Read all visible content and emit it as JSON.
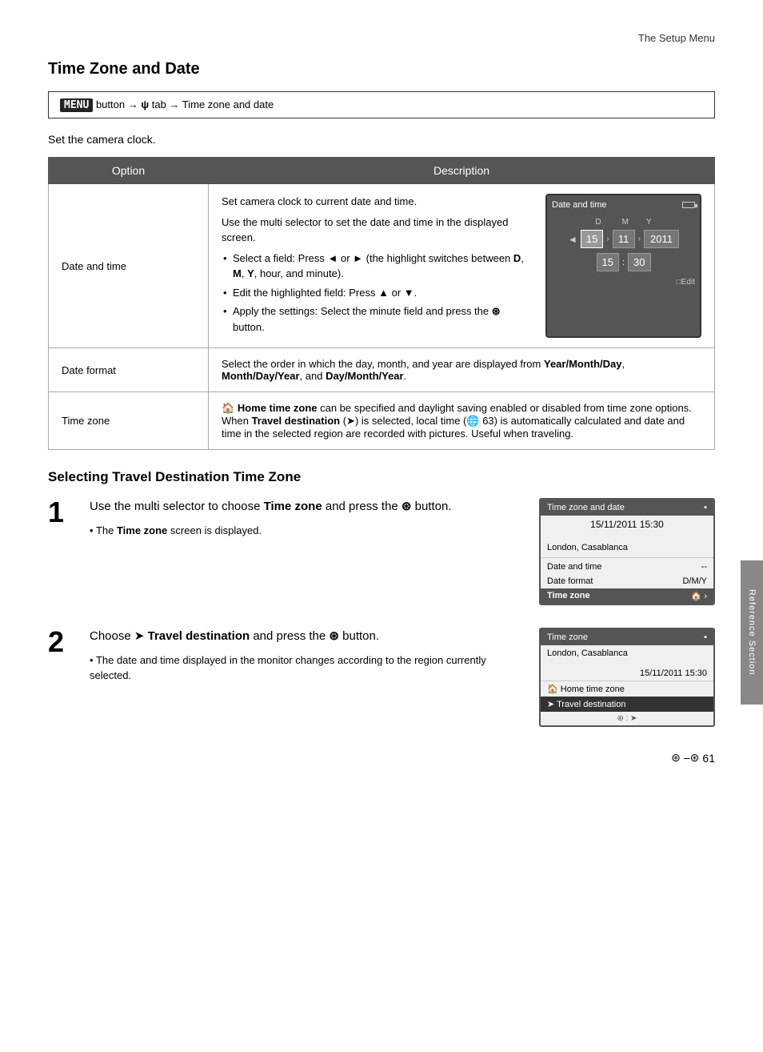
{
  "header": {
    "section_title": "The Setup Menu"
  },
  "title": "Time Zone and Date",
  "menu_path": {
    "button_label": "MENU",
    "path_text": " button → ψ tab → Time zone and date"
  },
  "intro_text": "Set the camera clock.",
  "table": {
    "col_option": "Option",
    "col_description": "Description",
    "rows": [
      {
        "option": "Date and time",
        "description_parts": [
          "Set camera clock to current date and time.",
          "Use the multi selector to set the date and time in the displayed screen."
        ],
        "bullets": [
          "Select a field: Press ◄ or ► (the highlight switches between D, M, Y, hour, and minute).",
          "Edit the highlighted field: Press ▲ or ▼.",
          "Apply the settings: Select the minute field and press the ® button."
        ],
        "screen": {
          "title": "Date and time",
          "d_label": "D",
          "m_label": "M",
          "y_label": "Y",
          "d_val": "15",
          "m_val": "11",
          "y_val": "2011",
          "h_val": "15",
          "min_val": "30",
          "edit_label": "□Edit"
        }
      },
      {
        "option": "Date format",
        "description": "Select the order in which the day, month, and year are displayed from Year/Month/Day, Month/Day/Year, and Day/Month/Year."
      },
      {
        "option": "Time zone",
        "description_intro": "🏠 Home time zone can be specified and daylight saving enabled or disabled from time zone options. When Travel destination (➤) is selected, local time (🌐 63) is automatically calculated and date and time in the selected region are recorded with pictures. Useful when traveling."
      }
    ]
  },
  "section2_title": "Selecting Travel Destination Time Zone",
  "steps": [
    {
      "number": "1",
      "main_text": "Use the multi selector to choose Time zone and press the ® button.",
      "note": "The Time zone screen is displayed.",
      "screen": {
        "title": "Time zone and date",
        "time": "15/11/2011 15:30",
        "location": "London, Casablanca",
        "row1_label": "Date and time",
        "row1_val": "--",
        "row2_label": "Date format",
        "row2_val": "D/M/Y",
        "row3_label": "Time zone",
        "row3_icon": "🏠"
      }
    },
    {
      "number": "2",
      "main_text": "Choose ➤ Travel destination and press the ® button.",
      "note": "The date and time displayed in the monitor changes according to the region currently selected.",
      "screen": {
        "title": "Time zone",
        "location": "London, Casablanca",
        "time": "15/11/2011 15:30",
        "row1_label": "🏠 Home time zone",
        "row2_label": "➤ Travel destination",
        "ok_label": "® : ➤"
      }
    }
  ],
  "sidebar_label": "Reference Section",
  "footer": {
    "page_icon": "🌐",
    "page_number": "61"
  }
}
